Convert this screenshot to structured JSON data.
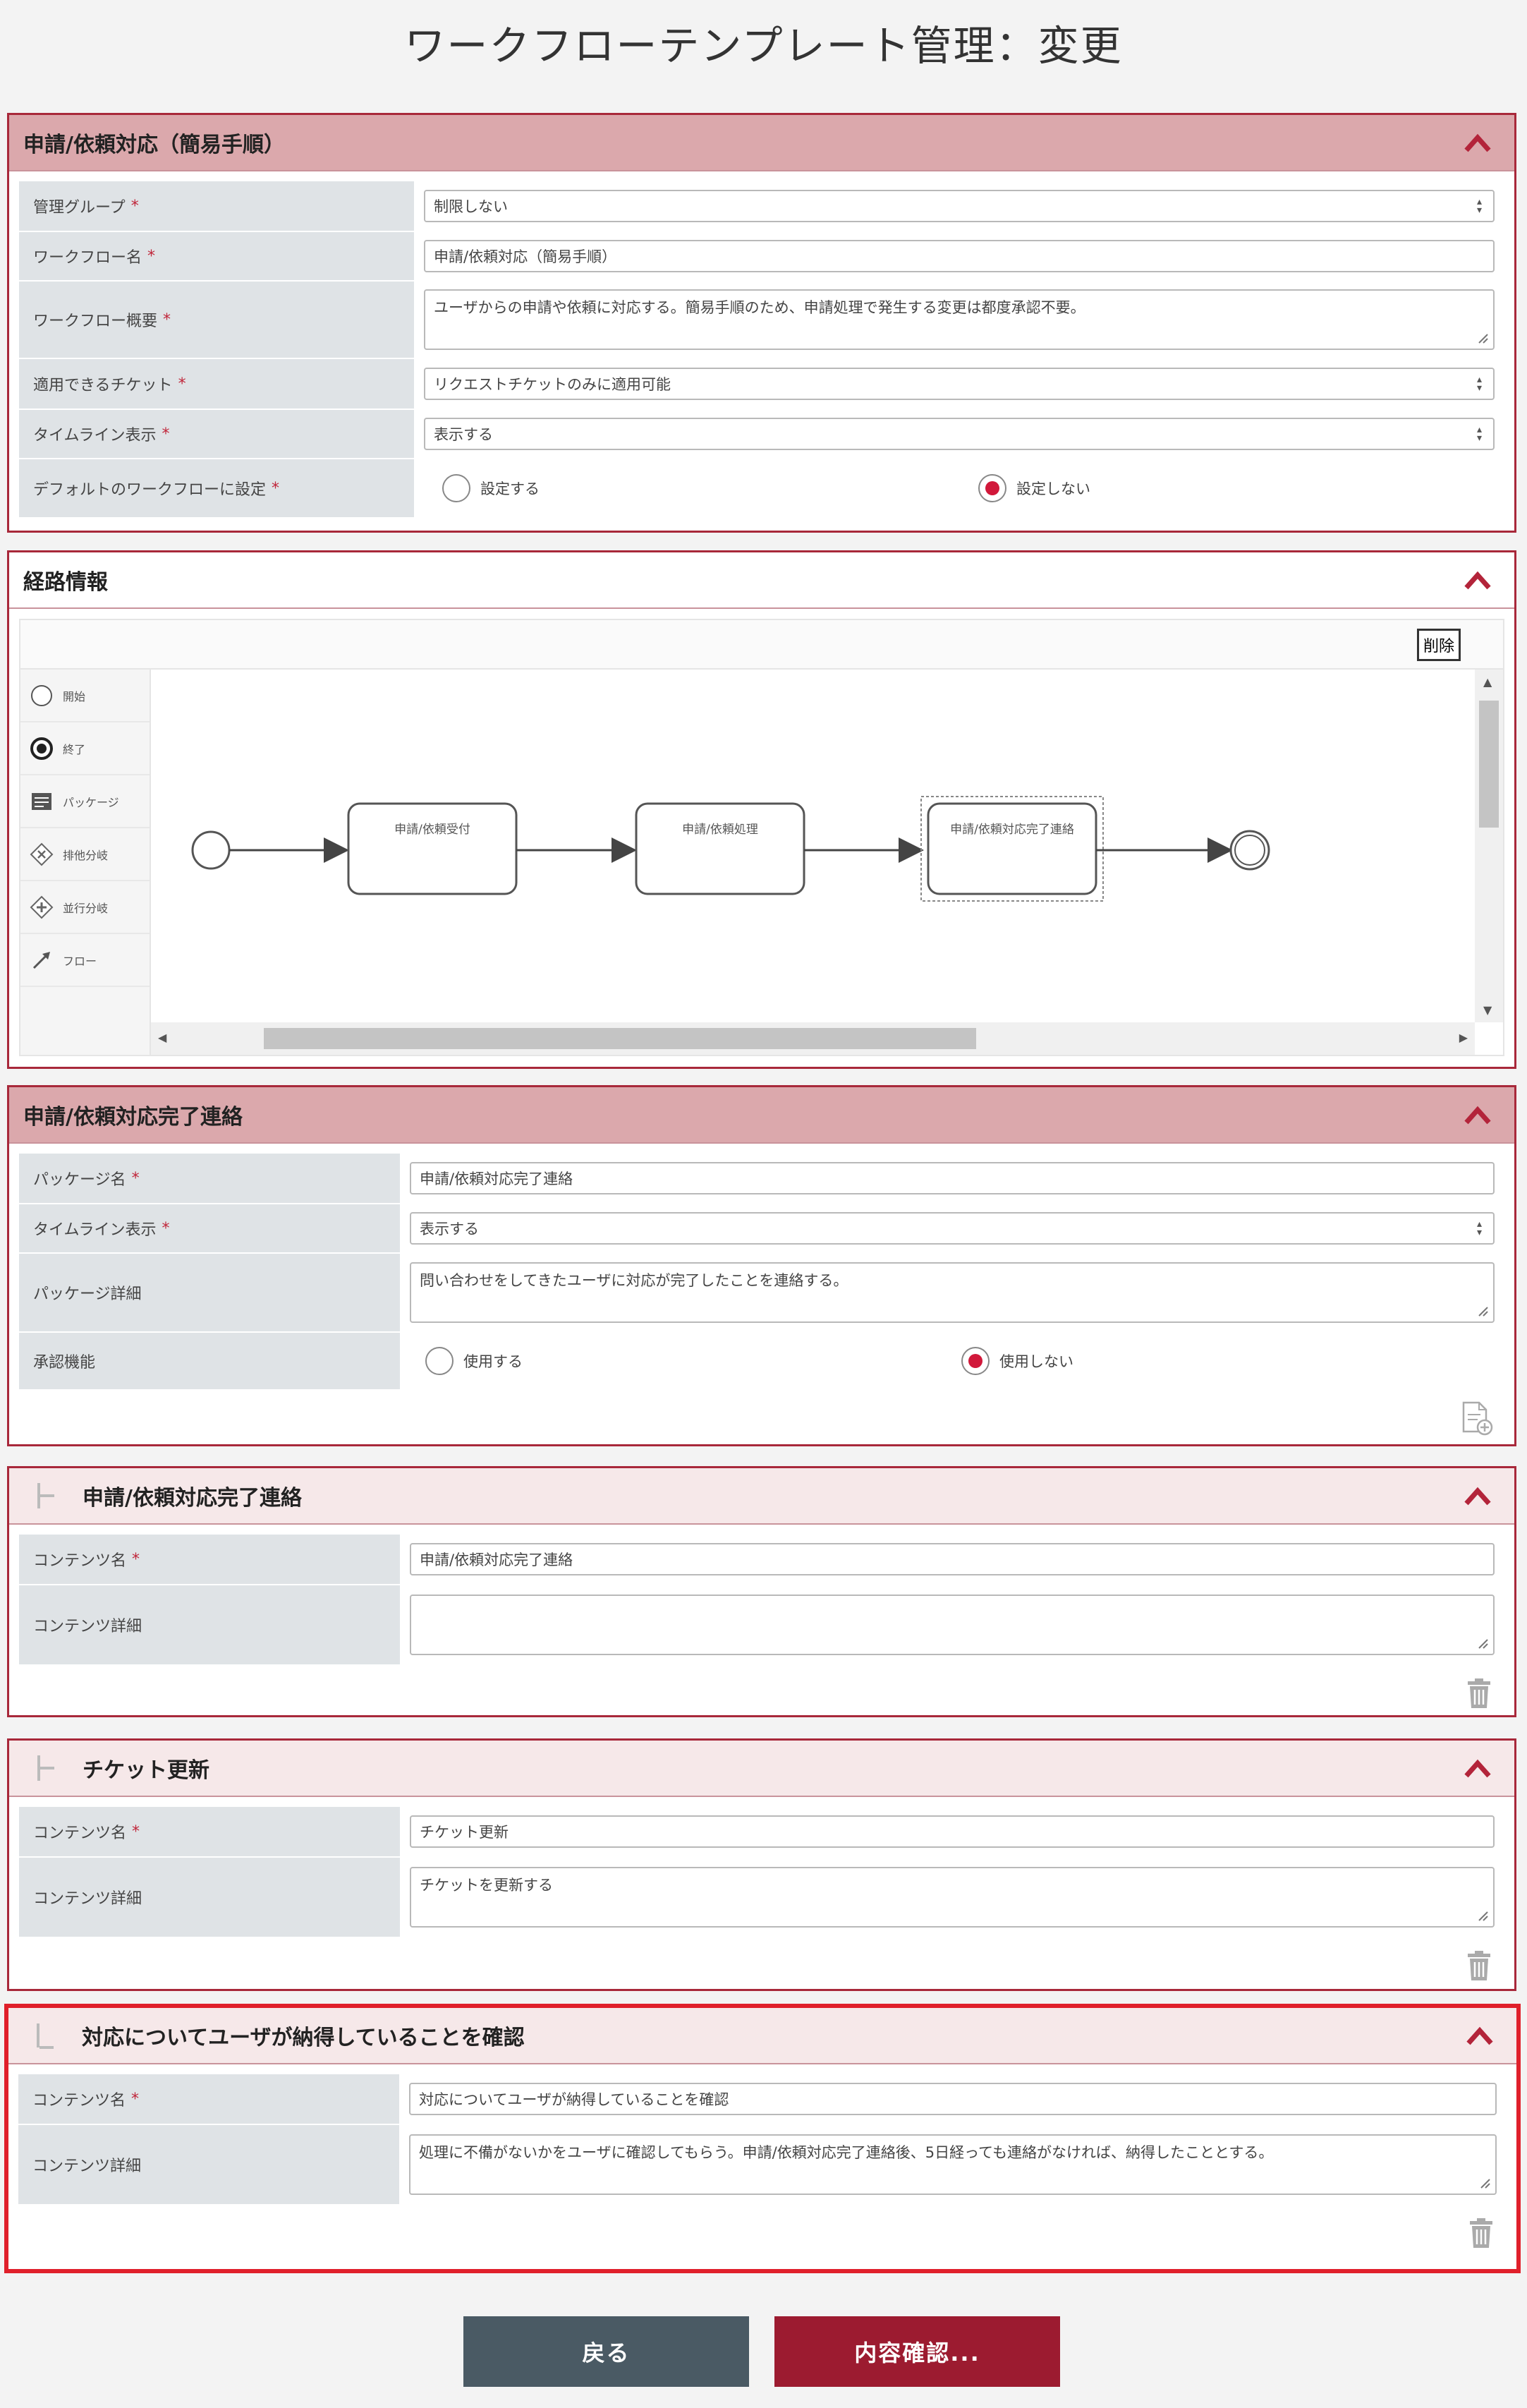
{
  "page": {
    "title": "ワークフローテンプレート管理：変更"
  },
  "workflow": {
    "header": "申請/依頼対応（簡易手順）",
    "fields": {
      "group_label": "管理グループ",
      "group_value": "制限しない",
      "name_label": "ワークフロー名",
      "name_value": "申請/依頼対応（簡易手順）",
      "summary_label": "ワークフロー概要",
      "summary_value": "ユーザからの申請や依頼に対応する。簡易手順のため、申請処理で発生する変更は都度承認不要。",
      "ticket_label": "適用できるチケット",
      "ticket_value": "リクエストチケットのみに適用可能",
      "timeline_label": "タイムライン表示",
      "timeline_value": "表示する",
      "default_label": "デフォルトのワークフローに設定",
      "default_opt_yes": "設定する",
      "default_opt_no": "設定しない",
      "default_selected": "設定しない"
    }
  },
  "route": {
    "header": "経路情報",
    "delete_label": "削除",
    "palette": [
      {
        "label": "開始",
        "icon": "start-event-icon"
      },
      {
        "label": "終了",
        "icon": "end-event-icon"
      },
      {
        "label": "パッケージ",
        "icon": "package-icon"
      },
      {
        "label": "排他分岐",
        "icon": "exclusive-gateway-icon"
      },
      {
        "label": "並行分岐",
        "icon": "parallel-gateway-icon"
      },
      {
        "label": "フロー",
        "icon": "flow-arrow-icon"
      }
    ],
    "nodes": [
      "申請/依頼受付",
      "申請/依頼処理",
      "申請/依頼対応完了連絡"
    ],
    "selected_node": "申請/依頼対応完了連絡"
  },
  "package": {
    "header": "申請/依頼対応完了連絡",
    "name_label": "パッケージ名",
    "name_value": "申請/依頼対応完了連絡",
    "timeline_label": "タイムライン表示",
    "timeline_value": "表示する",
    "detail_label": "パッケージ詳細",
    "detail_value": "問い合わせをしてきたユーザに対応が完了したことを連絡する。",
    "approval_label": "承認機能",
    "approval_opt_yes": "使用する",
    "approval_opt_no": "使用しない",
    "approval_selected": "使用しない"
  },
  "contents": [
    {
      "header": "申請/依頼対応完了連絡",
      "name_label": "コンテンツ名",
      "name_value": "申請/依頼対応完了連絡",
      "detail_label": "コンテンツ詳細",
      "detail_value": ""
    },
    {
      "header": "チケット更新",
      "name_label": "コンテンツ名",
      "name_value": "チケット更新",
      "detail_label": "コンテンツ詳細",
      "detail_value": "チケットを更新する"
    },
    {
      "header": "対応についてユーザが納得していることを確認",
      "name_label": "コンテンツ名",
      "name_value": "対応についてユーザが納得していることを確認",
      "detail_label": "コンテンツ詳細",
      "detail_value": "処理に不備がないかをユーザに確認してもらう。申請/依頼対応完了連絡後、5日経っても連絡がなければ、納得したこととする。"
    }
  ],
  "buttons": {
    "back": "戻る",
    "confirm": "内容確認..."
  },
  "colors": {
    "accent": "#a8283a",
    "highlight": "#e0202b",
    "radio_checked": "#d1183a",
    "back_button": "#4a5a64",
    "confirm_button": "#9c1b30"
  }
}
